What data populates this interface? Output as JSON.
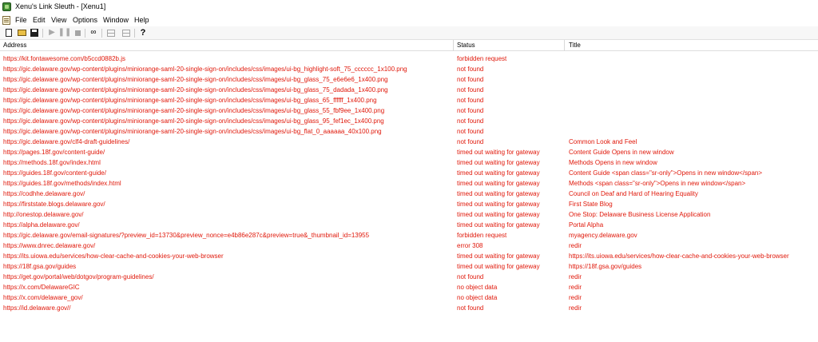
{
  "window": {
    "title": "Xenu's Link Sleuth - [Xenu1]"
  },
  "menu": [
    "File",
    "Edit",
    "View",
    "Options",
    "Window",
    "Help"
  ],
  "toolbar": {
    "icons": [
      "new-icon",
      "open-icon",
      "save-icon",
      "play-icon",
      "pause-icon",
      "stop-icon",
      "find-icon",
      "properties-icon",
      "report-icon",
      "help-icon"
    ],
    "help_glyph": "?"
  },
  "columns": {
    "address": "Address",
    "status": "Status",
    "title": "Title"
  },
  "colors": {
    "error_text": "#e0180a"
  },
  "rows": [
    {
      "address": "https://kit.fontawesome.com/b5ccd0882b.js",
      "status": "forbidden request",
      "title": ""
    },
    {
      "address": "https://gic.delaware.gov/wp-content/plugins/miniorange-saml-20-single-sign-on/includes/css/images/ui-bg_highlight-soft_75_cccccc_1x100.png",
      "status": "not found",
      "title": ""
    },
    {
      "address": "https://gic.delaware.gov/wp-content/plugins/miniorange-saml-20-single-sign-on/includes/css/images/ui-bg_glass_75_e6e6e6_1x400.png",
      "status": "not found",
      "title": ""
    },
    {
      "address": "https://gic.delaware.gov/wp-content/plugins/miniorange-saml-20-single-sign-on/includes/css/images/ui-bg_glass_75_dadada_1x400.png",
      "status": "not found",
      "title": ""
    },
    {
      "address": "https://gic.delaware.gov/wp-content/plugins/miniorange-saml-20-single-sign-on/includes/css/images/ui-bg_glass_65_ffffff_1x400.png",
      "status": "not found",
      "title": ""
    },
    {
      "address": "https://gic.delaware.gov/wp-content/plugins/miniorange-saml-20-single-sign-on/includes/css/images/ui-bg_glass_55_fbf9ee_1x400.png",
      "status": "not found",
      "title": ""
    },
    {
      "address": "https://gic.delaware.gov/wp-content/plugins/miniorange-saml-20-single-sign-on/includes/css/images/ui-bg_glass_95_fef1ec_1x400.png",
      "status": "not found",
      "title": ""
    },
    {
      "address": "https://gic.delaware.gov/wp-content/plugins/miniorange-saml-20-single-sign-on/includes/css/images/ui-bg_flat_0_aaaaaa_40x100.png",
      "status": "not found",
      "title": ""
    },
    {
      "address": "https://gic.delaware.gov/clf4-draft-guidelines/",
      "status": "not found",
      "title": "Common Look and Feel"
    },
    {
      "address": "https://pages.18f.gov/content-guide/",
      "status": "timed out waiting for gateway",
      "title": "Content Guide Opens in new window"
    },
    {
      "address": "https://methods.18f.gov/index.html",
      "status": "timed out waiting for gateway",
      "title": "Methods Opens in new window"
    },
    {
      "address": "https://guides.18f.gov/content-guide/",
      "status": "timed out waiting for gateway",
      "title": "Content Guide <span class=\"sr-only\">Opens in new window</span>"
    },
    {
      "address": "https://guides.18f.gov/methods/index.html",
      "status": "timed out waiting for gateway",
      "title": "Methods <span class=\"sr-only\">Opens in new window</span>"
    },
    {
      "address": "https://codhhe.delaware.gov/",
      "status": "timed out waiting for gateway",
      "title": "Council on Deaf and Hard of Hearing Equality"
    },
    {
      "address": "https://firststate.blogs.delaware.gov/",
      "status": "timed out waiting for gateway",
      "title": "First State Blog"
    },
    {
      "address": "http://onestop.delaware.gov/",
      "status": "timed out waiting for gateway",
      "title": "One Stop: Delaware Business License Application"
    },
    {
      "address": "https://alpha.delaware.gov/",
      "status": "timed out waiting for gateway",
      "title": "Portal Alpha"
    },
    {
      "address": "https://gic.delaware.gov/email-signatures/?preview_id=13730&preview_nonce=e4b86e287c&preview=true&_thumbnail_id=13955",
      "status": "forbidden request",
      "title": "myagency.delaware.gov"
    },
    {
      "address": "https://www.dnrec.delaware.gov/",
      "status": "error 308",
      "title": "redir"
    },
    {
      "address": "https://its.uiowa.edu/services/how-clear-cache-and-cookies-your-web-browser",
      "status": "timed out waiting for gateway",
      "title": "https://its.uiowa.edu/services/how-clear-cache-and-cookies-your-web-browser"
    },
    {
      "address": "https://18f.gsa.gov/guides",
      "status": "timed out waiting for gateway",
      "title": "https://18f.gsa.gov/guides"
    },
    {
      "address": "https://get.gov/portal/web/dotgov/program-guidelines/",
      "status": "not found",
      "title": "redir"
    },
    {
      "address": "https://x.com/DelawareGIC",
      "status": "no object data",
      "title": "redir"
    },
    {
      "address": "https://x.com/delaware_gov/",
      "status": "no object data",
      "title": "redir"
    },
    {
      "address": "https://id.delaware.gov//",
      "status": "not found",
      "title": "redir"
    }
  ]
}
